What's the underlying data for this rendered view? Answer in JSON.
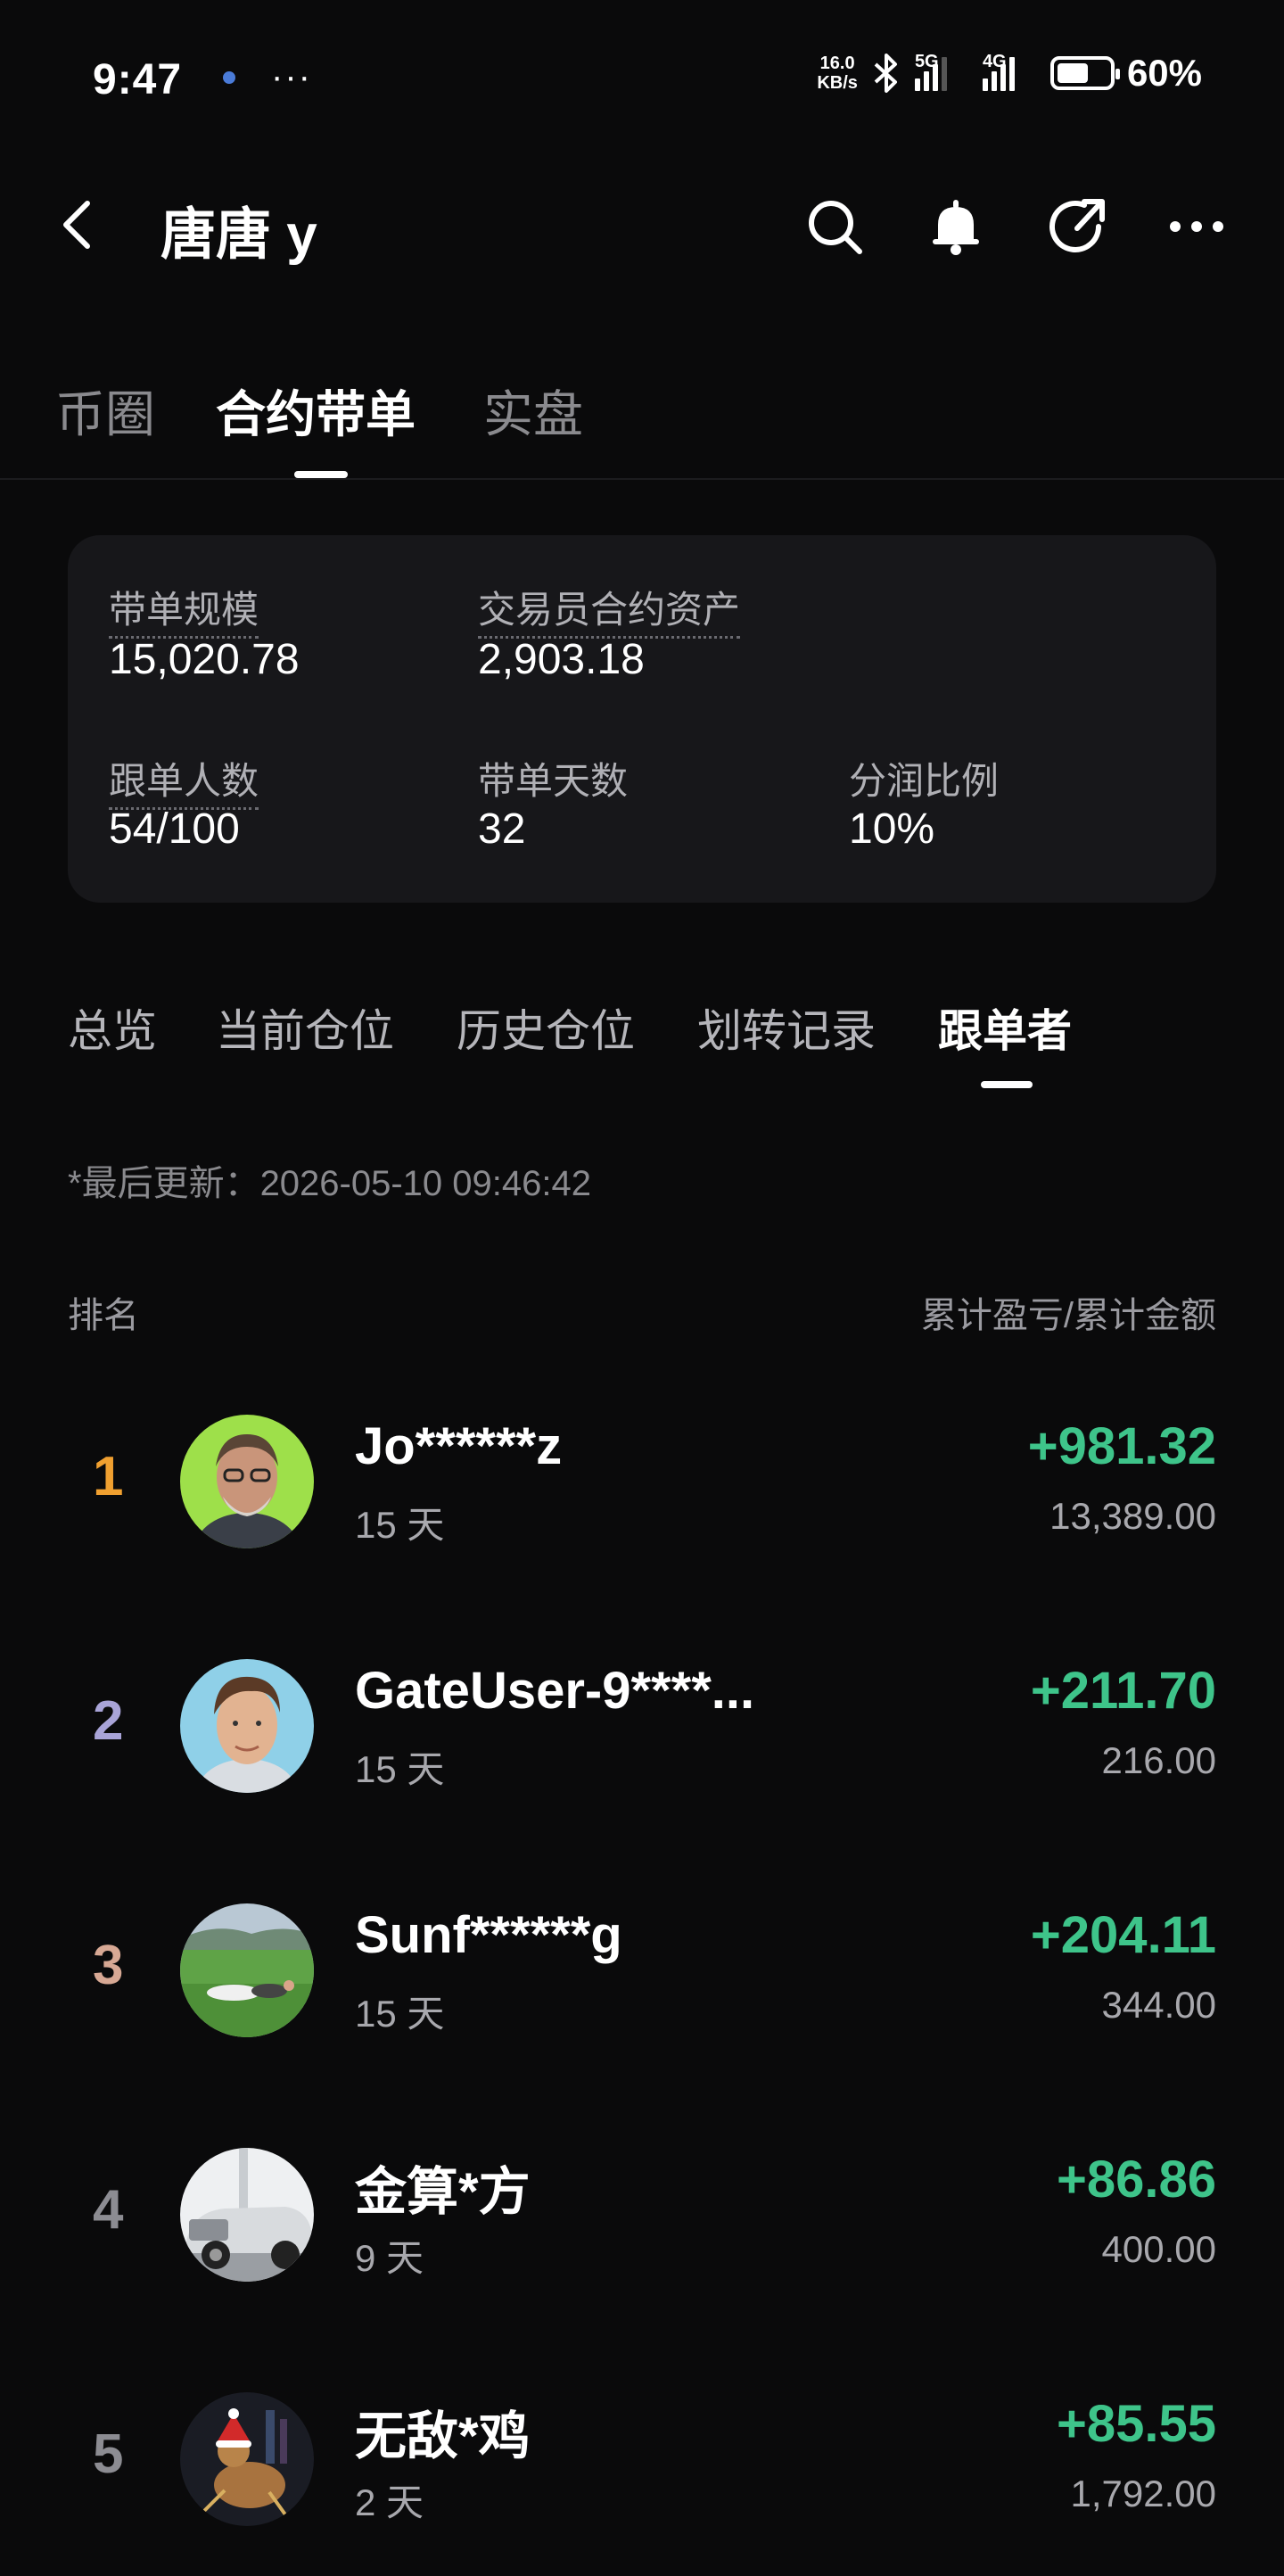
{
  "status_bar": {
    "time": "9:47",
    "more": "···",
    "net_speed_value": "16.0",
    "net_speed_unit": "KB/s",
    "sig1_label": "5G",
    "sig2_label": "4G",
    "battery_level": 0.6,
    "battery_text": "60%",
    "icons": [
      "location-dot-icon",
      "bluetooth-icon",
      "signal-icon",
      "battery-icon"
    ]
  },
  "header": {
    "title": "唐唐 y",
    "icons": [
      "back-icon",
      "search-icon",
      "bell-icon",
      "share-icon",
      "more-icon"
    ]
  },
  "top_tabs": [
    {
      "label": "币圈",
      "active": false
    },
    {
      "label": "合约带单",
      "active": true
    },
    {
      "label": "实盘",
      "active": false
    }
  ],
  "stats": {
    "scale_label": "带单规模",
    "scale_value": "15,020.78",
    "assets_label": "交易员合约资产",
    "assets_value": "2,903.18",
    "followers_label": "跟单人数",
    "followers_value": "54/100",
    "days_label": "带单天数",
    "days_value": "32",
    "share_label": "分润比例",
    "share_value": "10%"
  },
  "sub_tabs": [
    {
      "label": "总览",
      "active": false
    },
    {
      "label": "当前仓位",
      "active": false
    },
    {
      "label": "历史仓位",
      "active": false
    },
    {
      "label": "划转记录",
      "active": false
    },
    {
      "label": "跟单者",
      "active": true
    }
  ],
  "last_update": "*最后更新：2026-05-10 09:46:42",
  "table_header": {
    "rank": "排名",
    "value": "累计盈亏/累计金额"
  },
  "followers": [
    {
      "rank": "1",
      "name": "Jo******z",
      "days": "15 天",
      "pnl": "+981.32",
      "amount": "13,389.00",
      "rank_color": "#f0a030"
    },
    {
      "rank": "2",
      "name": "GateUser-9****...",
      "days": "15 天",
      "pnl": "+211.70",
      "amount": "216.00",
      "rank_color": "#a9a4d8"
    },
    {
      "rank": "3",
      "name": "Sunf******g",
      "days": "15 天",
      "pnl": "+204.11",
      "amount": "344.00",
      "rank_color": "#d7a894"
    },
    {
      "rank": "4",
      "name": "金算*方",
      "days": "9 天",
      "pnl": "+86.86",
      "amount": "400.00",
      "rank_color": "#8c8c92"
    },
    {
      "rank": "5",
      "name": "无敌*鸡",
      "days": "2 天",
      "pnl": "+85.55",
      "amount": "1,792.00",
      "rank_color": "#8c8c92"
    }
  ],
  "colors": {
    "background": "#0a0a0b",
    "card": "#17171a",
    "profit_green": "#3ec48a"
  }
}
